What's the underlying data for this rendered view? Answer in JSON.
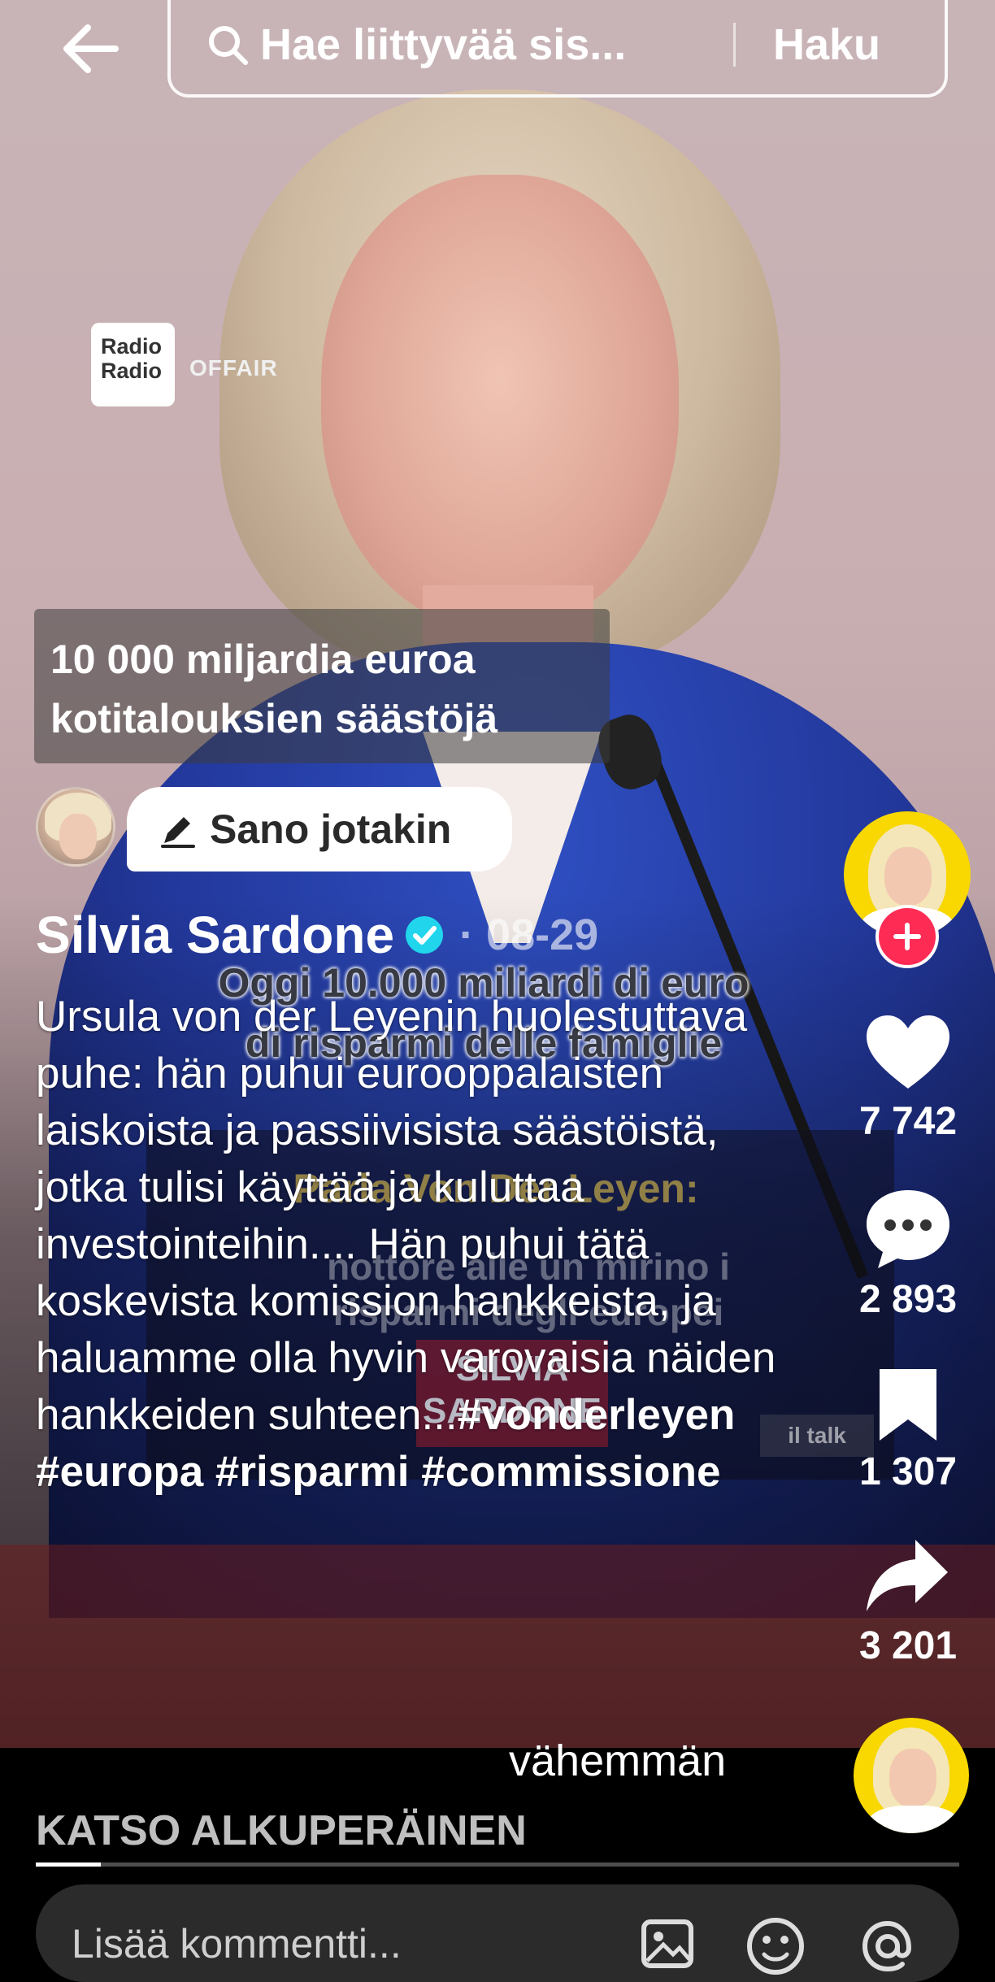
{
  "search": {
    "query": "Hae liittyvää sis...",
    "button_label": "Haku"
  },
  "video": {
    "logo_line1": "Radio",
    "logo_line2": "Radio",
    "logo_status": "OFFAIR",
    "burned_caption_line1": "Oggi 10.000 miliardi di euro",
    "burned_caption_line2": "di risparmi delle famiglie",
    "overlay_title": "Parla Von Der Leyen:",
    "overlay_subtitle_line1": "nottore alle un mirino i",
    "overlay_subtitle_line2": "risparmi degli europei",
    "badge_line1": "SILVIA",
    "badge_line2": "SARDONE",
    "badge_small": "il talk"
  },
  "title_box": {
    "line1": "10 000 miljardia euroa",
    "line2": "kotitalouksien säästöjä"
  },
  "say_something": {
    "label": "Sano jotakin"
  },
  "post": {
    "author": "Silvia Sardone",
    "date": "· 08-29",
    "description": "Ursula von der Leyenin huolestuttava puhe: hän puhui eurooppalaisten laiskoista ja passiivisista säästöistä, jotka tulisi käyttää ja kuluttaa investointeihin.... Hän puhui tätä koskevista komission hankkeista, ja haluamme olla hyvin varovaisia näiden hankkeiden suhteen...",
    "hashtags": "#vonderleyen #europa #risparmi #commissione",
    "less_label": "vähemmän",
    "watch_original": "KATSO ALKUPERÄINEN",
    "progress": 0.07
  },
  "actions": {
    "likes": "7 742",
    "comments": "2 893",
    "saves": "1 307",
    "shares": "3 201"
  },
  "comment_bar": {
    "placeholder": "Lisää kommentti..."
  },
  "colors": {
    "follow": "#fe2c55",
    "verified": "#20d5ec",
    "avatar_bg": "#f8d800"
  },
  "icons": [
    "back-arrow-icon",
    "search-icon",
    "pen-icon",
    "verified-icon",
    "plus-icon",
    "heart-icon",
    "comment-icon",
    "bookmark-icon",
    "share-icon",
    "image-icon",
    "emoji-icon",
    "mention-icon"
  ]
}
